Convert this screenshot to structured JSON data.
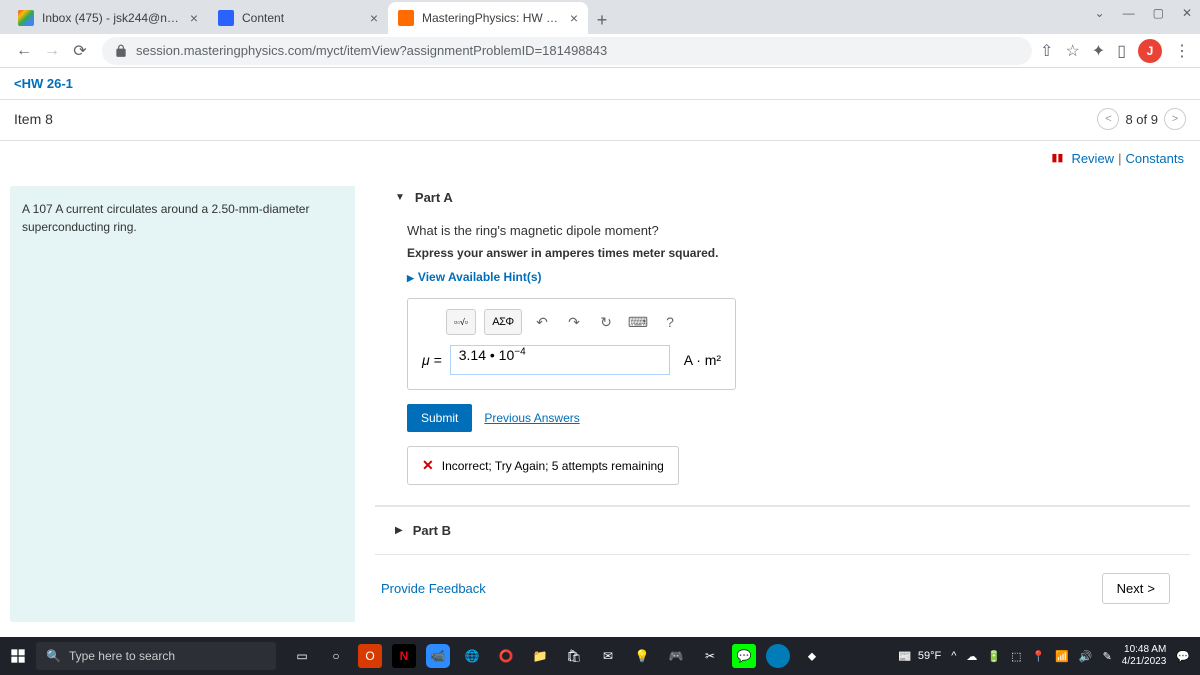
{
  "browser": {
    "tabs": [
      {
        "title": "Inbox (475) - jsk244@nau.edu - N"
      },
      {
        "title": "Content"
      },
      {
        "title": "MasteringPhysics: HW 26-1"
      }
    ],
    "url": "session.masteringphysics.com/myct/itemView?assignmentProblemID=181498843",
    "profile_initial": "J"
  },
  "page": {
    "breadcrumb": "HW 26-1",
    "item_label": "Item 8",
    "item_counter": "8 of 9",
    "review_link": "Review",
    "constants_link": "Constants"
  },
  "problem": {
    "text": "A 107 A current circulates around a 2.50-mm-diameter superconducting ring."
  },
  "partA": {
    "title": "Part A",
    "question": "What is the ring's magnetic dipole moment?",
    "instruction": "Express your answer in amperes times meter squared.",
    "hints_label": "View Available Hint(s)",
    "mu_label": "μ =",
    "answer_value": "3.14 • 10",
    "answer_exp": "−4",
    "unit": "A · m²",
    "submit_label": "Submit",
    "prev_answers": "Previous Answers",
    "feedback": "Incorrect; Try Again; 5 attempts remaining",
    "toolbar": {
      "greek": "ΑΣΦ",
      "help": "?"
    }
  },
  "partB": {
    "title": "Part B"
  },
  "footer": {
    "feedback": "Provide Feedback",
    "next": "Next"
  },
  "taskbar": {
    "search_placeholder": "Type here to search",
    "weather": "59°F",
    "time": "10:48 AM",
    "date": "4/21/2023"
  }
}
